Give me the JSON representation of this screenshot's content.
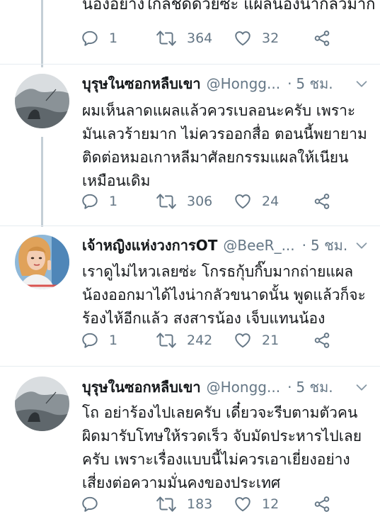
{
  "top": {
    "text": "น้องอย่างใกล้ชิดด้วยซ่ะ แผลน้องน่ากลัวมาก",
    "reply_count": "1",
    "retweet_count": "364",
    "like_count": "32"
  },
  "tweets": [
    {
      "name": "บุรุษในซอกหลืบเขา",
      "handle": "@Hongg...",
      "dot": "·",
      "time": "5 ชม.",
      "lines": [
        "ผมเห็นลาดแผลแล้วควรเบลอนะครับ เพราะ",
        "มันเลวร้ายมาก ไม่ควรออกสื่อ ตอนนี้พยายาม",
        "ติดต่อหมอเกาหลีมาศัลยกรรมแผลให้เนียน",
        "เหมือนเดิม"
      ],
      "reply_count": "1",
      "retweet_count": "306",
      "like_count": "24"
    },
    {
      "name": "เจ้าหญิงแห่งวงการOT",
      "handle": "@BeeR_...",
      "dot": "·",
      "time": "5 ชม.",
      "lines": [
        "เราดูไม่ไหวเลยซ่ะ โกรธกุ้บกิ๊บมากถ่ายแผล",
        "น้องออกมาได้ไงน่ากลัวขนาดนั้น พูดแล้วก็จะ",
        "ร้องไห้อีกแล้ว สงสารน้อง เจ็บแทนน้อง"
      ],
      "reply_count": "1",
      "retweet_count": "242",
      "like_count": "21"
    },
    {
      "name": "บุรุษในซอกหลืบเขา",
      "handle": "@Hongg...",
      "dot": "·",
      "time": "5 ชม.",
      "lines": [
        "โถ อย่าร้องไปเลยครับ เดี๋ยวจะรีบตามตัวคน",
        "ผิดมารับโทษให้รวดเร็ว จับมัดประหารไปเลย",
        "ครับ เพราะเรื่องแบบนี้ไม่ควรเอาเยี่ยงอย่าง",
        "เสี่ยงต่อความมั่นคงของประเทศ"
      ],
      "reply_count": "",
      "retweet_count": "183",
      "like_count": "12"
    }
  ],
  "colors": {
    "text": "#14171a",
    "muted": "#657786",
    "thread": "#c4cfd6",
    "divider": "#e6ecf0"
  },
  "icons": [
    "reply-icon",
    "retweet-icon",
    "like-icon",
    "share-icon",
    "chevron-down-icon"
  ]
}
